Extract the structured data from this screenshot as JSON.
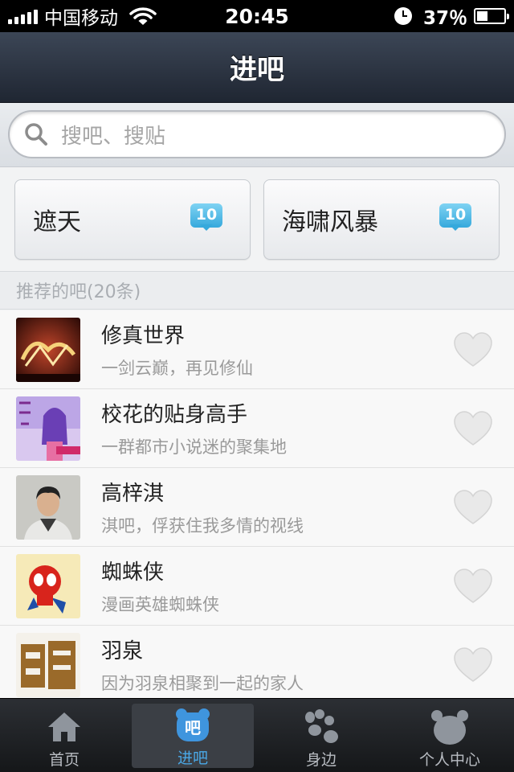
{
  "status_bar": {
    "carrier": "中国移动",
    "time": "20:45",
    "battery": "37％",
    "battery_level": 0.37
  },
  "nav": {
    "title": "进吧"
  },
  "search": {
    "placeholder": "搜吧、搜贴"
  },
  "tiles": [
    {
      "label": "遮天",
      "badge": "10"
    },
    {
      "label": "海啸风暴",
      "badge": "10"
    }
  ],
  "section": {
    "title": "推荐的吧(20条)"
  },
  "list": [
    {
      "name": "修真世界",
      "desc": "一剑云巅，再见修仙",
      "thumb": "xiuzhen-cover"
    },
    {
      "name": "校花的贴身高手",
      "desc": "一群都市小说迷的聚集地",
      "thumb": "xiaohua-cover"
    },
    {
      "name": "高梓淇",
      "desc": "淇吧，俘获住我多情的视线",
      "thumb": "portrait-photo"
    },
    {
      "name": "蜘蛛侠",
      "desc": "漫画英雄蜘蛛侠",
      "thumb": "spiderman-cartoon"
    },
    {
      "name": "羽泉",
      "desc": "因为羽泉相聚到一起的家人",
      "thumb": "yuquan-logo"
    }
  ],
  "tabbar": [
    {
      "label": "首页",
      "icon": "home-icon",
      "active": false
    },
    {
      "label": "进吧",
      "icon": "ba-icon",
      "active": true
    },
    {
      "label": "身边",
      "icon": "paw-icon",
      "active": false
    },
    {
      "label": "个人中心",
      "icon": "bear-icon",
      "active": false
    }
  ],
  "colors": {
    "accent": "#4aa9e8",
    "badge": "#36a9dc",
    "nav": "#2b3341"
  }
}
